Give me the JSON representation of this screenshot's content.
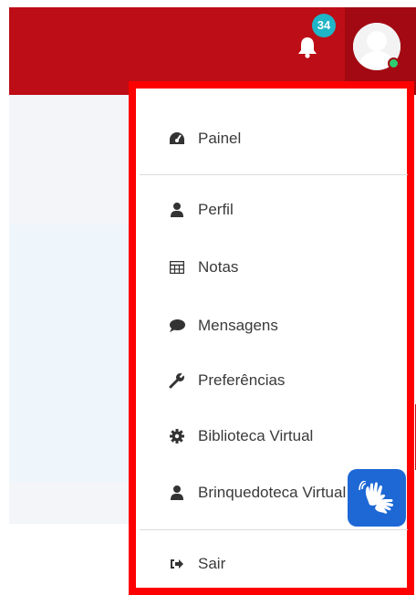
{
  "header": {
    "notifications": {
      "count": "34",
      "icon": "bell-icon"
    },
    "user": {
      "icon": "user-avatar-icon",
      "status": "online"
    },
    "colors": {
      "brand": "#bd0d16",
      "brand_dark": "#a20912",
      "badge": "#1fb5c7",
      "online": "#2ecc71"
    }
  },
  "menu": {
    "items": [
      {
        "label": "Painel",
        "icon": "dashboard-icon"
      },
      {
        "label": "Perfil",
        "icon": "user-icon"
      },
      {
        "label": "Notas",
        "icon": "table-icon"
      },
      {
        "label": "Mensagens",
        "icon": "comment-icon"
      },
      {
        "label": "Preferências",
        "icon": "wrench-icon"
      },
      {
        "label": "Biblioteca Virtual",
        "icon": "gear-icon"
      },
      {
        "label": "Brinquedoteca Virtual",
        "icon": "user-icon"
      },
      {
        "label": "Sair",
        "icon": "sign-out-icon"
      }
    ],
    "highlight_color": "#ff0000"
  },
  "accessibility": {
    "icon": "sign-language-icon",
    "color": "#1d68d5"
  }
}
